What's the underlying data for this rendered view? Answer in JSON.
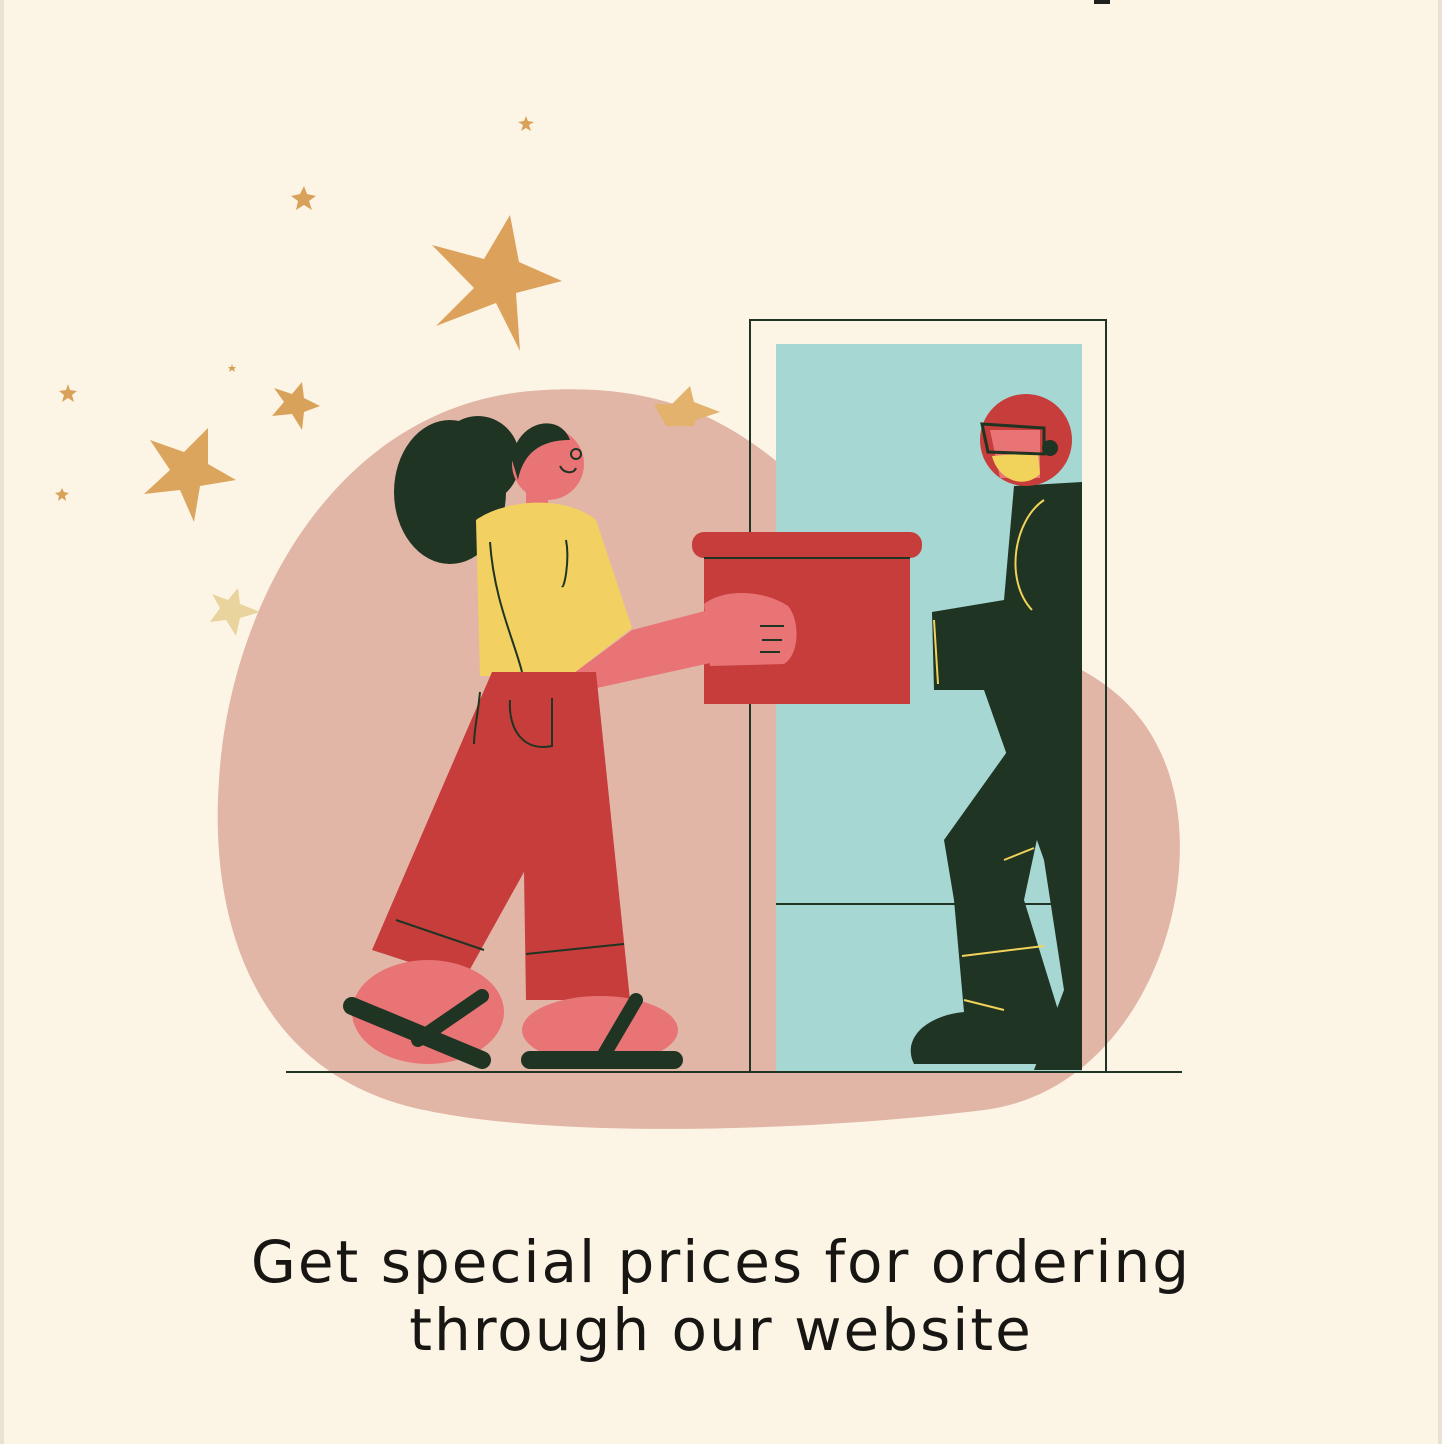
{
  "tagline": {
    "line1": "Get special prices for ordering",
    "line2": "through our website"
  },
  "colors": {
    "background": "#fcf5e6",
    "blob": "#e2b6a6",
    "door": "#a6d7d3",
    "star_gold": "#d9a25a",
    "shirt": "#f3d062",
    "pants": "#c63d3b",
    "skin": "#e87476",
    "courier_suit": "#1f3422",
    "glove": "#f1d25a",
    "box": "#c63d3b",
    "text": "#171613"
  },
  "icons": [
    "star-icon",
    "package-box-icon",
    "courier-figure",
    "customer-figure",
    "doorway"
  ]
}
